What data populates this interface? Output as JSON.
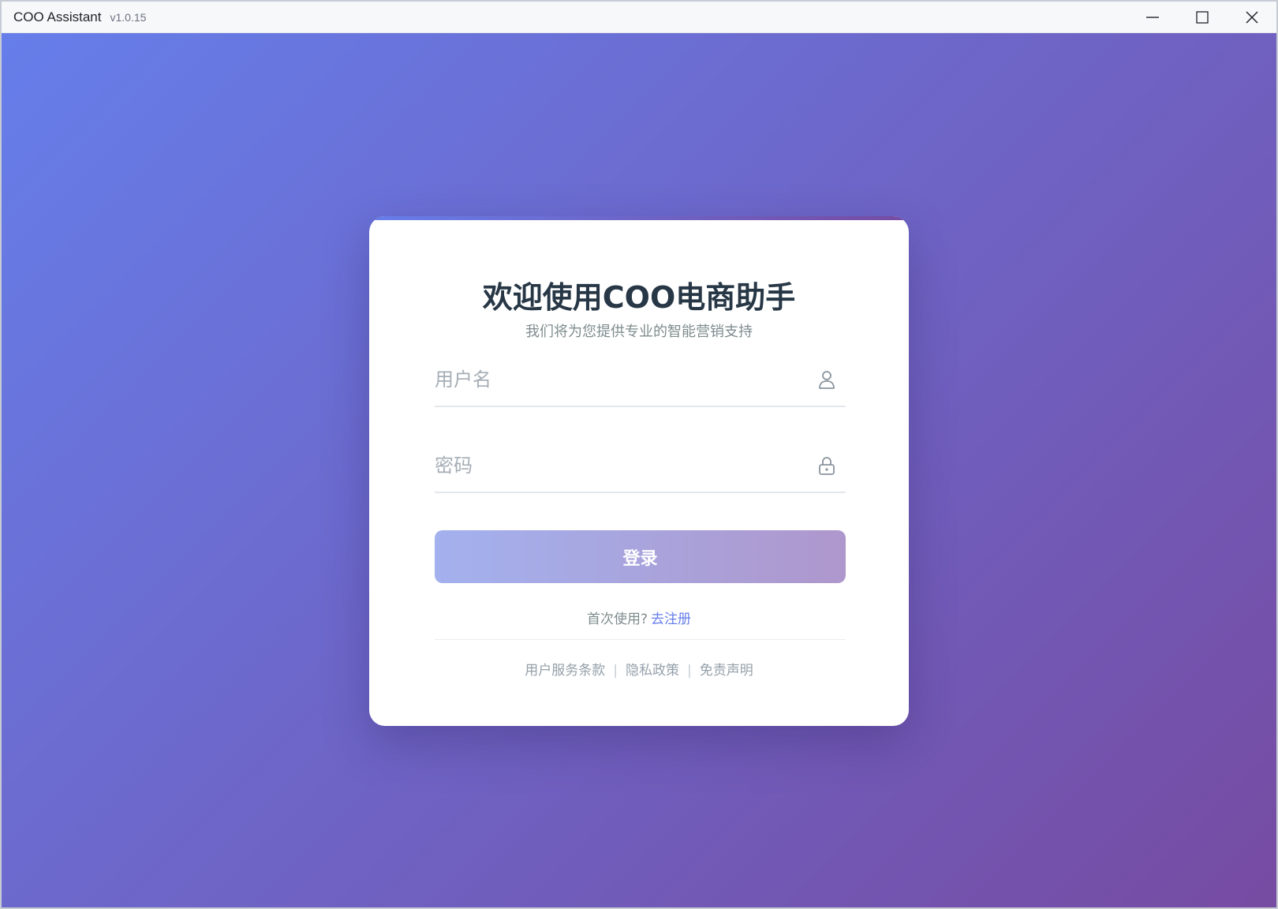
{
  "window": {
    "title": "COO Assistant",
    "version": "v1.0.15",
    "controls": [
      "minimize-icon",
      "maximize-icon",
      "close-icon"
    ]
  },
  "theme": {
    "gradient_start": "#667eea",
    "gradient_end": "#764ba2",
    "heading_color": "#273746",
    "link_color": "#667eea"
  },
  "login": {
    "title": "欢迎使用COO电商助手",
    "subtitle": "我们将为您提供专业的智能营销支持",
    "username": {
      "placeholder": "用户名",
      "value": "",
      "icon": "user-icon"
    },
    "password": {
      "placeholder": "密码",
      "value": "",
      "icon": "lock-icon"
    },
    "submit_label": "登录",
    "register_prompt": "首次使用?",
    "register_link": "去注册",
    "footer_links": [
      "用户服务条款",
      "隐私政策",
      "免责声明"
    ]
  }
}
